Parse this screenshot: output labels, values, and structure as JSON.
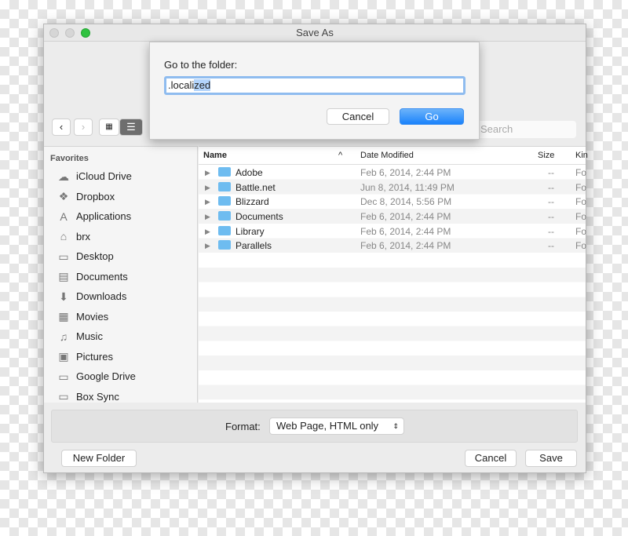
{
  "window": {
    "title": "Save As"
  },
  "goto": {
    "label": "Go to the folder:",
    "value_plain": ".locali",
    "value_selected": "zed",
    "cancel": "Cancel",
    "go": "Go"
  },
  "toolbar": {
    "search_placeholder": "Search"
  },
  "sidebar": {
    "header": "Favorites",
    "items": [
      {
        "label": "iCloud Drive",
        "icon": "cloud-icon",
        "glyph": "☁"
      },
      {
        "label": "Dropbox",
        "icon": "dropbox-icon",
        "glyph": "❖"
      },
      {
        "label": "Applications",
        "icon": "applications-icon",
        "glyph": "A"
      },
      {
        "label": "brx",
        "icon": "home-icon",
        "glyph": "⌂"
      },
      {
        "label": "Desktop",
        "icon": "desktop-icon",
        "glyph": "▭"
      },
      {
        "label": "Documents",
        "icon": "documents-icon",
        "glyph": "▤"
      },
      {
        "label": "Downloads",
        "icon": "downloads-icon",
        "glyph": "⬇"
      },
      {
        "label": "Movies",
        "icon": "movies-icon",
        "glyph": "▦"
      },
      {
        "label": "Music",
        "icon": "music-icon",
        "glyph": "♫"
      },
      {
        "label": "Pictures",
        "icon": "pictures-icon",
        "glyph": "▣"
      },
      {
        "label": "Google Drive",
        "icon": "folder-icon",
        "glyph": "▭"
      },
      {
        "label": "Box Sync",
        "icon": "folder-icon",
        "glyph": "▭"
      }
    ]
  },
  "list": {
    "columns": {
      "name": "Name",
      "date": "Date Modified",
      "size": "Size",
      "kind": "Kin"
    },
    "rows": [
      {
        "name": "Adobe",
        "date": "Feb 6, 2014, 2:44 PM",
        "size": "--",
        "kind": "Fo"
      },
      {
        "name": "Battle.net",
        "date": "Jun 8, 2014, 11:49 PM",
        "size": "--",
        "kind": "Fo"
      },
      {
        "name": "Blizzard",
        "date": "Dec 8, 2014, 5:56 PM",
        "size": "--",
        "kind": "Fo"
      },
      {
        "name": "Documents",
        "date": "Feb 6, 2014, 2:44 PM",
        "size": "--",
        "kind": "Fo"
      },
      {
        "name": "Library",
        "date": "Feb 6, 2014, 2:44 PM",
        "size": "--",
        "kind": "Fo"
      },
      {
        "name": "Parallels",
        "date": "Feb 6, 2014, 2:44 PM",
        "size": "--",
        "kind": "Fo"
      }
    ]
  },
  "format": {
    "label": "Format:",
    "value": "Web Page, HTML only"
  },
  "buttons": {
    "new_folder": "New Folder",
    "cancel": "Cancel",
    "save": "Save"
  }
}
